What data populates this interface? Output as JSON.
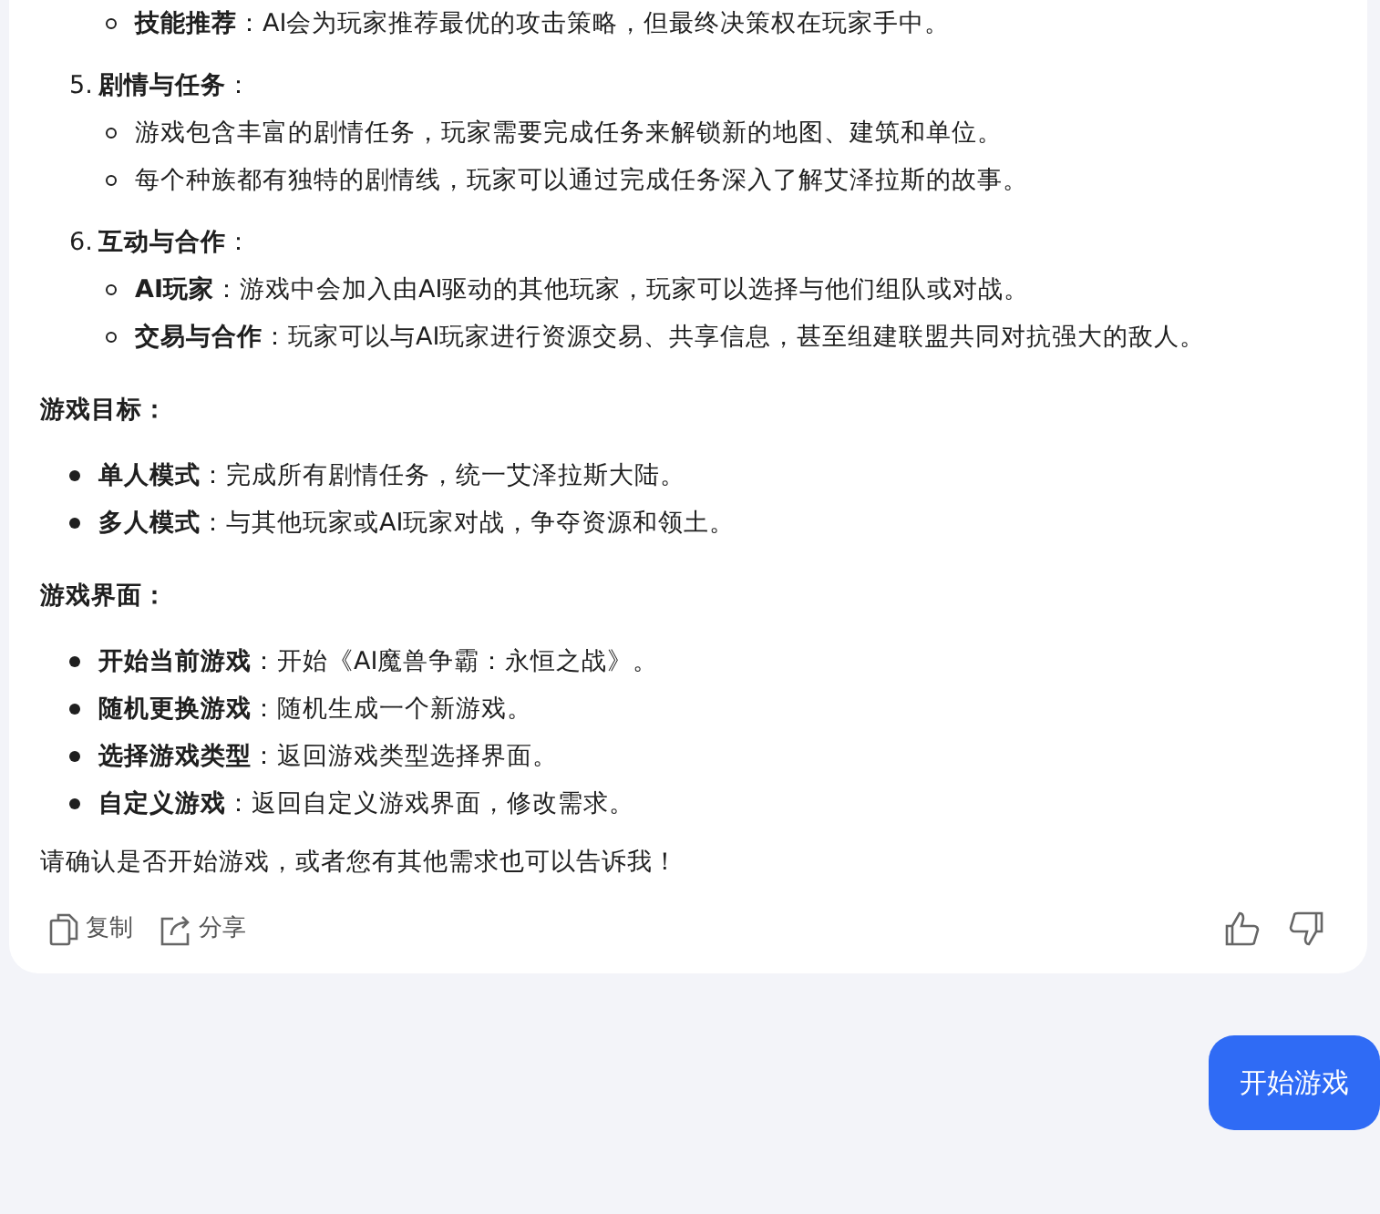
{
  "message": {
    "top_item": "**技能推荐**：AI会为玩家推荐最优的攻击策略，但最终决策权在玩家手中。",
    "ordered_items": [
      {
        "number": "5.",
        "title": "**剧情与任务**：",
        "bullets": [
          "游戏包含丰富的剧情任务，玩家需要完成任务来解锁新的地图、建筑和单位。",
          "每个种族都有独特的剧情线，玩家可以通过完成任务深入了解艾泽拉斯的故事。"
        ]
      },
      {
        "number": "6.",
        "title": "**互动与合作**：",
        "bullets": [
          "**AI玩家**：游戏中会加入由AI驱动的其他玩家，玩家可以选择与他们组队或对战。",
          "**交易与合作**：玩家可以与AI玩家进行资源交易、共享信息，甚至组建联盟共同对抗强大的敌人。"
        ]
      }
    ],
    "sections": [
      {
        "heading": "游戏目标：",
        "bullets": [
          "**单人模式**：完成所有剧情任务，统一艾泽拉斯大陆。",
          "**多人模式**：与其他玩家或AI玩家对战，争夺资源和领土。"
        ]
      },
      {
        "heading": "游戏界面：",
        "bullets": [
          "**开始当前游戏**：开始《AI魔兽争霸：永恒之战》。",
          "**随机更换游戏**：随机生成一个新游戏。",
          "**选择游戏类型**：返回游戏类型选择界面。",
          "**自定义游戏**：返回自定义游戏界面，修改需求。"
        ]
      }
    ],
    "closing": "请确认是否开始游戏，或者您有其他需求也可以告诉我！",
    "actions": [
      {
        "kind": "copy",
        "label": "复制"
      },
      {
        "kind": "share",
        "label": "分享"
      }
    ],
    "feedback": [
      {
        "kind": "like"
      },
      {
        "kind": "dislike"
      }
    ]
  },
  "reply_button": {
    "label": "开始游戏"
  }
}
